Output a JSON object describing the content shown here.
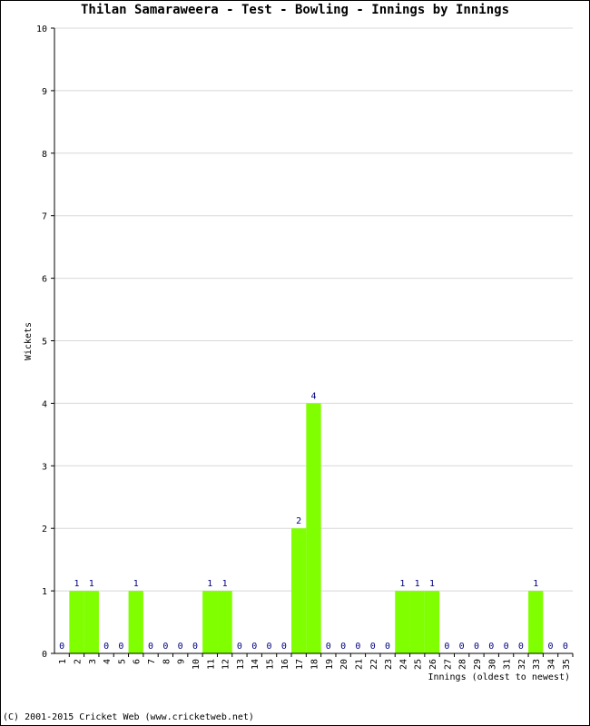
{
  "chart_data": {
    "type": "bar",
    "title": "Thilan Samaraweera - Test - Bowling - Innings by Innings",
    "xlabel": "Innings (oldest to newest)",
    "ylabel": "Wickets",
    "ylim": [
      0,
      10
    ],
    "yticks": [
      0,
      1,
      2,
      3,
      4,
      5,
      6,
      7,
      8,
      9,
      10
    ],
    "grid": true,
    "categories": [
      "1",
      "2",
      "3",
      "4",
      "5",
      "6",
      "7",
      "8",
      "9",
      "10",
      "11",
      "12",
      "13",
      "14",
      "15",
      "16",
      "17",
      "18",
      "19",
      "20",
      "21",
      "22",
      "23",
      "24",
      "25",
      "26",
      "27",
      "28",
      "29",
      "30",
      "31",
      "32",
      "33",
      "34",
      "35"
    ],
    "values": [
      0,
      1,
      1,
      0,
      0,
      1,
      0,
      0,
      0,
      0,
      1,
      1,
      0,
      0,
      0,
      0,
      2,
      4,
      0,
      0,
      0,
      0,
      0,
      1,
      1,
      1,
      0,
      0,
      0,
      0,
      0,
      0,
      1,
      0,
      0
    ],
    "bar_color": "#80ff00",
    "label_color": "#000080"
  },
  "footer": "(C) 2001-2015 Cricket Web (www.cricketweb.net)"
}
